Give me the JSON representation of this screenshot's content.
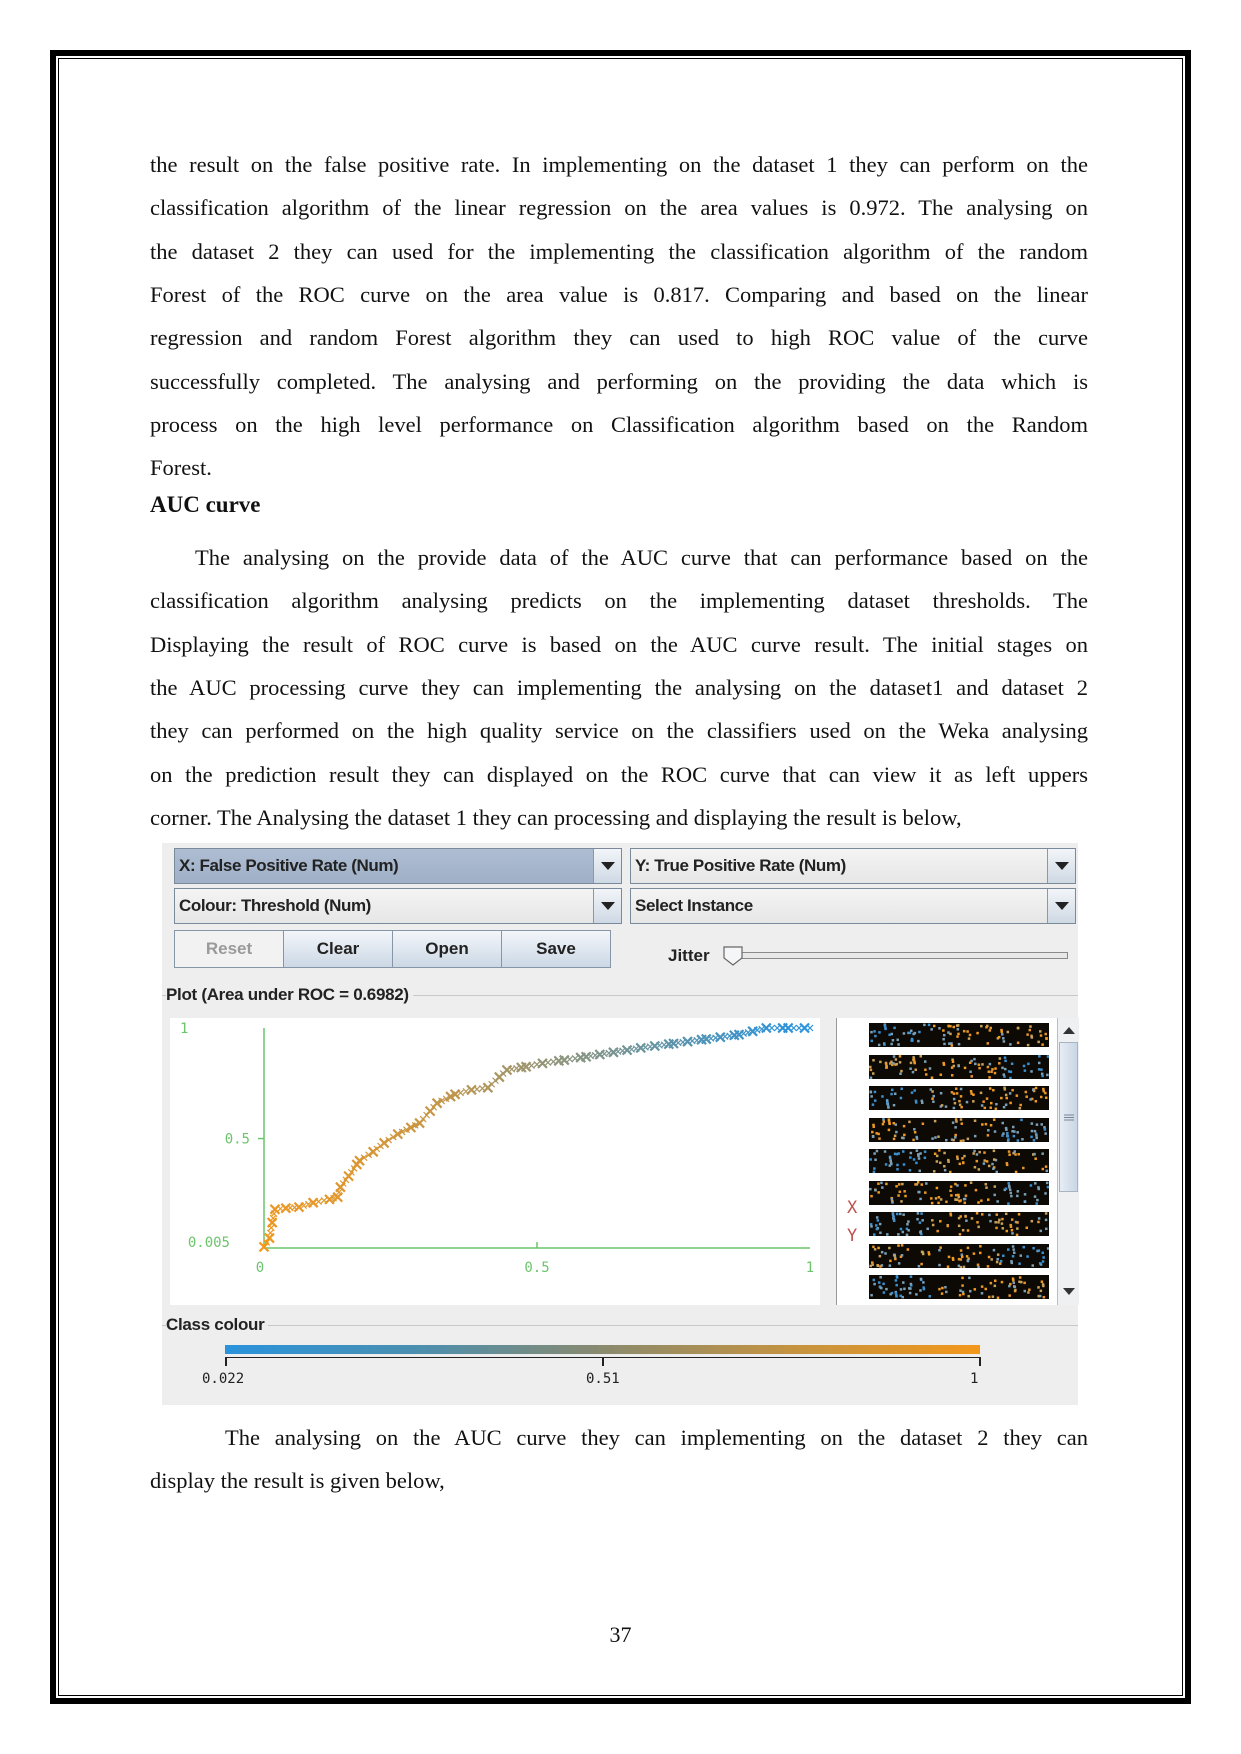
{
  "document": {
    "paragraph1_lines": [
      "the result on the false positive rate. In implementing on the dataset 1 they can perform on the",
      "classification algorithm of the linear regression on the area values is 0.972. The analysing on",
      "the dataset 2 they can used for the implementing the classification algorithm of the random",
      "Forest of the ROC curve on the area value is 0.817. Comparing and based on the linear",
      "regression and random Forest algorithm they can used to high ROC value of the curve",
      "successfully completed. The analysing and performing on the providing the data which is",
      "process on the high level performance on Classification algorithm based on the Random",
      "Forest."
    ],
    "heading": "AUC curve",
    "paragraph2_lines": [
      "The analysing on the provide data of the AUC curve that can performance based on the",
      "classification algorithm analysing predicts on the implementing dataset thresholds. The",
      "Displaying the result of ROC curve is based on the AUC curve result. The initial stages on",
      "the AUC processing curve they can implementing the analysing on the dataset1 and dataset 2",
      "they can performed on the high quality service on the classifiers used on the Weka analysing",
      "on the prediction result they can displayed on the ROC curve that can view it as left uppers",
      "corner. The Analysing the dataset 1 they can processing and displaying the result is below,"
    ],
    "paragraph3_lines": [
      "The analysing on the AUC curve they can implementing on the dataset 2  they can",
      "display the result is given below,"
    ],
    "page_number": "37"
  },
  "weka": {
    "x_axis_combo": "X: False Positive Rate (Num)",
    "y_axis_combo": "Y: True Positive Rate (Num)",
    "colour_combo": "Colour: Threshold (Num)",
    "instance_combo": "Select Instance",
    "buttons": [
      "Reset",
      "Clear",
      "Open",
      "Save"
    ],
    "jitter_label": "Jitter",
    "jitter_value": 0,
    "plot_title": "Plot (Area under ROC = 0.6982)",
    "legend_axis_labels": [
      "X",
      "Y"
    ],
    "class_colour_title": "Class colour",
    "class_colour_ticks": [
      "0.022",
      "0.51",
      "1"
    ],
    "class_colour_low": "#2a93dc",
    "class_colour_high": "#f3971b"
  },
  "chart_data": {
    "type": "scatter",
    "title": "Plot (Area under ROC = 0.6982)",
    "xlabel": "False Positive Rate",
    "ylabel": "True Positive Rate",
    "x_tick_labels": [
      "0",
      "0.5",
      "1"
    ],
    "y_tick_labels": [
      "0.005",
      "0.5",
      "1"
    ],
    "xlim": [
      0,
      1
    ],
    "ylim": [
      0.005,
      1
    ],
    "colour_by": "Threshold",
    "colour_range": [
      0.022,
      1
    ],
    "points": [
      {
        "x": 0.0,
        "y": 0.01,
        "t": 1.0
      },
      {
        "x": 0.01,
        "y": 0.05,
        "t": 0.98
      },
      {
        "x": 0.015,
        "y": 0.12,
        "t": 0.97
      },
      {
        "x": 0.02,
        "y": 0.18,
        "t": 0.96
      },
      {
        "x": 0.04,
        "y": 0.185,
        "t": 0.95
      },
      {
        "x": 0.064,
        "y": 0.19,
        "t": 0.94
      },
      {
        "x": 0.09,
        "y": 0.21,
        "t": 0.93
      },
      {
        "x": 0.12,
        "y": 0.225,
        "t": 0.92
      },
      {
        "x": 0.135,
        "y": 0.235,
        "t": 0.91
      },
      {
        "x": 0.14,
        "y": 0.28,
        "t": 0.9
      },
      {
        "x": 0.155,
        "y": 0.33,
        "t": 0.89
      },
      {
        "x": 0.175,
        "y": 0.4,
        "t": 0.88
      },
      {
        "x": 0.2,
        "y": 0.44,
        "t": 0.86
      },
      {
        "x": 0.22,
        "y": 0.48,
        "t": 0.84
      },
      {
        "x": 0.245,
        "y": 0.52,
        "t": 0.82
      },
      {
        "x": 0.285,
        "y": 0.57,
        "t": 0.8
      },
      {
        "x": 0.317,
        "y": 0.66,
        "t": 0.77
      },
      {
        "x": 0.35,
        "y": 0.7,
        "t": 0.74
      },
      {
        "x": 0.38,
        "y": 0.72,
        "t": 0.7
      },
      {
        "x": 0.41,
        "y": 0.73,
        "t": 0.67
      },
      {
        "x": 0.445,
        "y": 0.81,
        "t": 0.62
      },
      {
        "x": 0.48,
        "y": 0.825,
        "t": 0.58
      },
      {
        "x": 0.51,
        "y": 0.84,
        "t": 0.54
      },
      {
        "x": 0.55,
        "y": 0.855,
        "t": 0.5
      },
      {
        "x": 0.59,
        "y": 0.87,
        "t": 0.46
      },
      {
        "x": 0.64,
        "y": 0.89,
        "t": 0.4
      },
      {
        "x": 0.69,
        "y": 0.91,
        "t": 0.34
      },
      {
        "x": 0.75,
        "y": 0.93,
        "t": 0.27
      },
      {
        "x": 0.81,
        "y": 0.95,
        "t": 0.2
      },
      {
        "x": 0.87,
        "y": 0.97,
        "t": 0.13
      },
      {
        "x": 0.92,
        "y": 1.0,
        "t": 0.07
      },
      {
        "x": 0.96,
        "y": 1.0,
        "t": 0.04
      },
      {
        "x": 1.0,
        "y": 1.0,
        "t": 0.022
      }
    ]
  }
}
